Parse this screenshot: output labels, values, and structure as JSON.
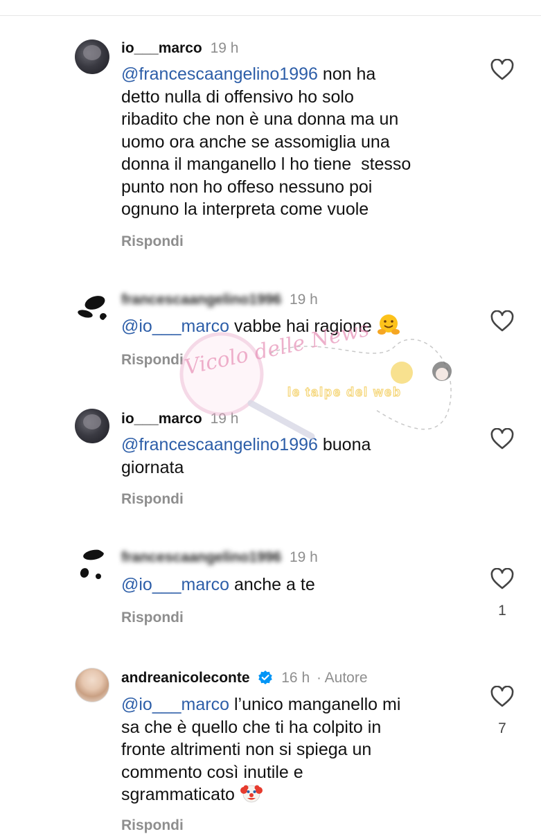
{
  "comments": [
    {
      "username": "io___marco",
      "time": "19 h",
      "mention": "@francescaangelino1996",
      "text": " non ha\ndetto nulla di offensivo ho solo\nribadito che non è una donna ma un\nuomo ora anche se assomiglia una\ndonna il manganello l ho tiene  stesso\npunto non ho offeso nessuno poi\nognuno la interpreta come vuole",
      "reply_label": "Rispondi",
      "avatar_icon": "profile-avatar"
    },
    {
      "username": "francescaangelino1996",
      "time": "19 h",
      "mention": "@io___marco",
      "text": " vabbe hai ragione ",
      "emoji": "hugging-face-emoji",
      "reply_label": "Rispondi",
      "avatar_icon": "profile-avatar"
    },
    {
      "username": "io___marco",
      "time": "19 h",
      "mention": "@francescaangelino1996",
      "text": " buona\ngiornata",
      "reply_label": "Rispondi",
      "avatar_icon": "profile-avatar"
    },
    {
      "username": "francescaangelino1996",
      "time": "19 h",
      "mention": "@io___marco",
      "text": " anche a te",
      "reply_label": "Rispondi",
      "likes": "1",
      "avatar_icon": "profile-avatar"
    },
    {
      "username": "andreanicoleconte",
      "time": "16 h",
      "author_tag": "· Autore",
      "mention": "@io___marco",
      "text": " l’unico manganello mi\nsa che è quello che ti ha colpito in\nfronte altrimenti non si spiega un\ncommento così inutile e\nsgrammaticato ",
      "emoji": "clown-face-emoji",
      "reply_label": "Rispondi",
      "likes": "7",
      "verified_icon": "verified-badge-icon",
      "avatar_icon": "profile-avatar"
    }
  ],
  "watermark": {
    "text1": "Vicolo delle News",
    "text2": "le talpe del web"
  },
  "colors": {
    "mention": "#2d5ea8",
    "muted": "#8e8e8e",
    "verified": "#0095f6"
  }
}
